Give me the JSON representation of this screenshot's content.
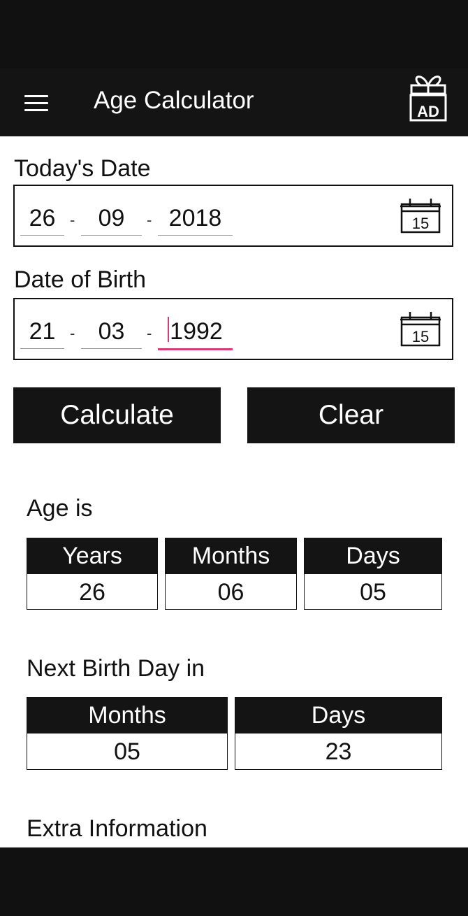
{
  "app_bar": {
    "title": "Age Calculator",
    "ad_badge": "AD",
    "menu_icon": "hamburger-menu-icon",
    "ad_icon": "gift-ad-icon"
  },
  "todays_date": {
    "label": "Today's Date",
    "day": "26",
    "month": "09",
    "year": "2018",
    "separator": "-",
    "calendar_day": "15"
  },
  "date_of_birth": {
    "label": "Date of Birth",
    "day": "21",
    "month": "03",
    "year": "1992",
    "separator": "-",
    "calendar_day": "15"
  },
  "buttons": {
    "calculate": "Calculate",
    "clear": "Clear"
  },
  "age": {
    "label": "Age is",
    "years_label": "Years",
    "years": "26",
    "months_label": "Months",
    "months": "06",
    "days_label": "Days",
    "days": "05"
  },
  "next_birthday": {
    "label": "Next Birth Day in",
    "months_label": "Months",
    "months": "05",
    "days_label": "Days",
    "days": "23"
  },
  "extra": {
    "label": "Extra Information"
  },
  "colors": {
    "bar": "#141414",
    "accent": "#d63b7a"
  }
}
